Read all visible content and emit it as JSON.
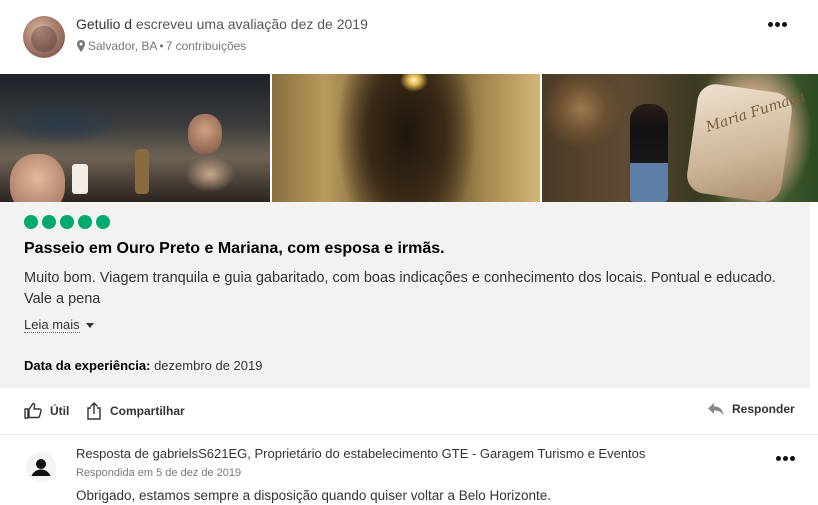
{
  "review": {
    "author": "Getulio d",
    "action_text": " escreveu uma avaliação dez de 2019",
    "location": "Salvador, BA",
    "separator": " • ",
    "contributions": "7 contribuições",
    "title": "Passeio em Ouro Preto e Mariana, com esposa e irmãs.",
    "body": "Muito bom. Viagem tranquila e guia gabaritado, com boas indicações e conhecimento dos locais. Pontual e educado. Vale a pena",
    "read_more": "Leia mais",
    "experience_label": "Data da experiência:",
    "experience_value": " dezembro de 2019",
    "rating_bubbles": 5,
    "rating_color": "#00aa6c",
    "photo_sign_text": "Maria Fumaça"
  },
  "actions": {
    "useful": "Útil",
    "share": "Compartilhar",
    "reply": "Responder"
  },
  "response": {
    "title": "Resposta de gabrielsS621EG, Proprietário do estabelecimento GTE - Garagem Turismo e Eventos",
    "date": "Respondida em 5 de dez de 2019",
    "body": "Obrigado, estamos sempre a disposição quando quiser voltar a Belo Horizonte."
  },
  "icons": {
    "more": "more-options-icon",
    "pin": "map-pin-icon",
    "useful": "thumbs-up-icon",
    "share": "share-icon",
    "reply": "reply-arrow-icon",
    "user": "user-avatar-icon"
  }
}
